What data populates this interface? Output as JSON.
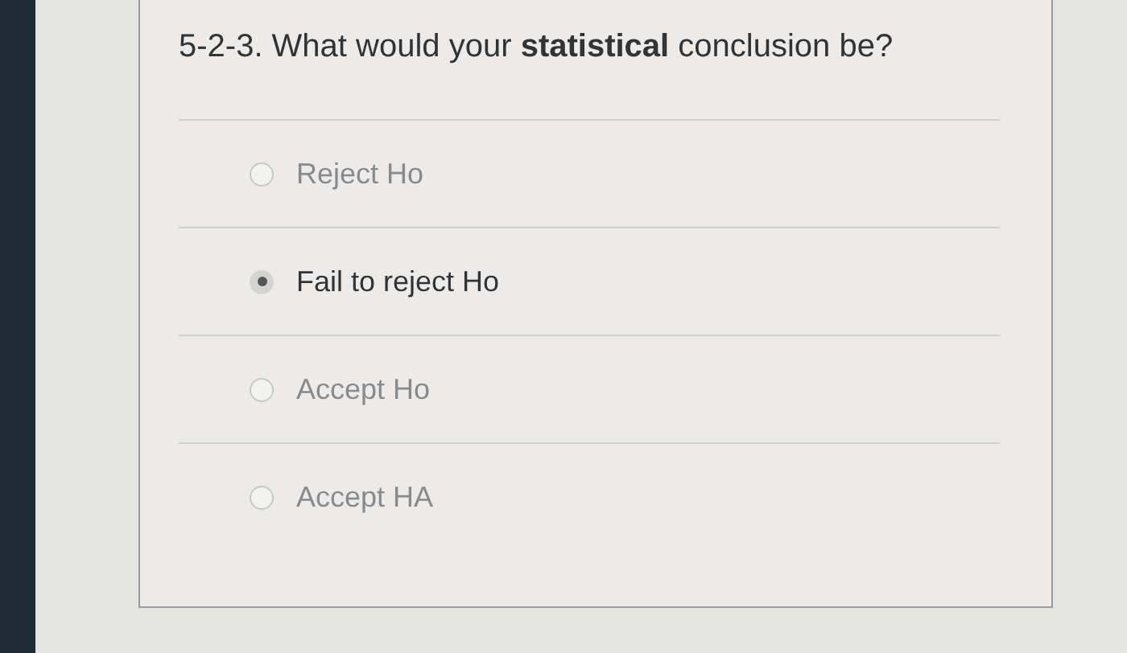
{
  "question": "5-2-3. What would your **statistical** conclusion be?",
  "options": [
    {
      "label": "Reject Ho",
      "selected": false
    },
    {
      "label": "Fail to reject Ho",
      "selected": true
    },
    {
      "label": "Accept Ho",
      "selected": false
    },
    {
      "label": "Accept HA",
      "selected": false
    }
  ]
}
